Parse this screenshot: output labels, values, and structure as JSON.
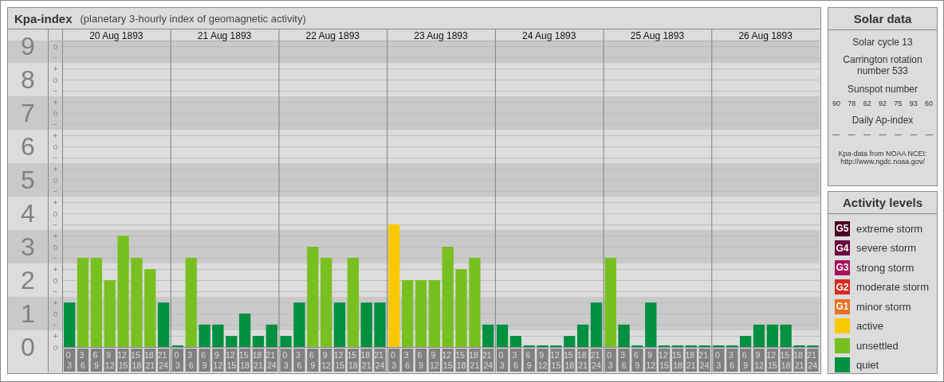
{
  "chart_panel": {
    "title": "Kpa-index",
    "subtitle": "(planetary 3-hourly index of geomagnetic activity)",
    "days": [
      "20 Aug 1893",
      "21 Aug 1893",
      "22 Aug 1893",
      "23 Aug 1893",
      "24 Aug 1893",
      "25 Aug 1893",
      "26 Aug 1893"
    ],
    "kp_steps": [
      "o",
      "−",
      "+",
      "o",
      "−",
      "+",
      "o",
      "−",
      "+",
      "o",
      "−",
      "+",
      "o",
      "−",
      "+",
      "o",
      "−",
      "+",
      "o",
      "−",
      "+",
      "o",
      "−",
      "+",
      "o",
      "−",
      "+",
      "o"
    ],
    "chart_data": {
      "type": "bar",
      "grid": true,
      "ylim": [
        0,
        9.17
      ],
      "categories": [
        "0 3",
        "3 6",
        "6 9",
        "9 12",
        "12 15",
        "15 18",
        "18 21",
        "21 24",
        "0 3",
        "3 6",
        "6 9",
        "9 12",
        "12 15",
        "15 18",
        "18 21",
        "21 24",
        "0 3",
        "3 6",
        "6 9",
        "9 12",
        "12 15",
        "15 18",
        "18 21",
        "21 24",
        "0 3",
        "3 6",
        "6 9",
        "9 12",
        "12 15",
        "15 18",
        "18 21",
        "21 24",
        "0 3",
        "3 6",
        "6 9",
        "9 12",
        "12 15",
        "15 18",
        "18 21",
        "21 24",
        "0 3",
        "3 6",
        "6 9",
        "9 12",
        "12 15",
        "15 18",
        "18 21",
        "21 24",
        "0 3",
        "3 6",
        "6 9",
        "9 12",
        "12 15",
        "15 18",
        "18 21",
        "21 24"
      ],
      "yticks": [
        {
          "value": 0,
          "label": "0"
        },
        {
          "value": 1,
          "label": "1"
        },
        {
          "value": 2,
          "label": "2"
        },
        {
          "value": 3,
          "label": "3"
        },
        {
          "value": 4,
          "label": "4"
        },
        {
          "value": 5,
          "label": "5"
        },
        {
          "value": 6,
          "label": "6"
        },
        {
          "value": 7,
          "label": "7"
        },
        {
          "value": 8,
          "label": "8"
        },
        {
          "value": 9,
          "label": "9"
        }
      ],
      "series": [
        {
          "color": "#009040",
          "values": [
            1.33,
            null,
            null,
            null,
            null,
            null,
            null,
            1.33,
            0,
            null,
            0.67,
            0.67,
            0.33,
            1,
            0.33,
            0.67,
            0.33,
            1.33,
            null,
            null,
            1.33,
            null,
            1.33,
            1.33,
            null,
            null,
            null,
            null,
            null,
            null,
            null,
            0.67,
            0.67,
            0.33,
            0,
            0,
            0,
            0.33,
            0.67,
            1.33,
            null,
            0.67,
            0,
            1.33,
            0,
            0,
            0,
            0,
            0,
            0,
            0.33,
            0.67,
            0.67,
            0.67,
            0,
            0
          ]
        },
        {
          "color": "#78c020",
          "values": [
            null,
            2.67,
            2.67,
            2,
            3.33,
            2.67,
            2.33,
            null,
            null,
            2.67,
            null,
            null,
            null,
            null,
            null,
            null,
            null,
            null,
            3,
            2.67,
            null,
            2.67,
            null,
            null,
            null,
            2,
            2,
            2,
            3,
            2.33,
            2.67,
            null,
            null,
            null,
            null,
            null,
            null,
            null,
            null,
            null,
            2.67,
            null,
            null,
            null,
            null,
            null,
            null,
            null,
            null,
            null,
            null,
            null,
            null,
            null,
            null,
            null
          ]
        },
        {
          "color": "#f8c800",
          "values": [
            null,
            null,
            null,
            null,
            null,
            null,
            null,
            null,
            null,
            null,
            null,
            null,
            null,
            null,
            null,
            null,
            null,
            null,
            null,
            null,
            null,
            null,
            null,
            null,
            3.67,
            null,
            null,
            null,
            null,
            null,
            null,
            null,
            null,
            null,
            null,
            null,
            null,
            null,
            null,
            null,
            null,
            null,
            null,
            null,
            null,
            null,
            null,
            null,
            null,
            null,
            null,
            null,
            null,
            null,
            null,
            null
          ]
        }
      ]
    }
  },
  "solar_data": {
    "title": "Solar data",
    "solar_cycle": "Solar cycle 13",
    "carrington_rotation": "Carrington rotation number 533",
    "sunspot_label": "Sunspot number",
    "sunspot_numbers": [
      "90",
      "78",
      "62",
      "92",
      "75",
      "93",
      "60"
    ],
    "ap_label": "Daily Ap-index",
    "ap_values": [
      "—",
      "—",
      "—",
      "—",
      "—",
      "—",
      "—"
    ],
    "source": "Kpa-data from NOAA NCEI:",
    "source_url": "http://www.ngdc.noaa.gov/"
  },
  "activity_levels": {
    "title": "Activity levels",
    "items": [
      {
        "badge": "G5",
        "label": "extreme storm",
        "color": "#4a0022"
      },
      {
        "badge": "G4",
        "label": "severe storm",
        "color": "#6a0040"
      },
      {
        "badge": "G3",
        "label": "strong storm",
        "color": "#a8105c"
      },
      {
        "badge": "G2",
        "label": "moderate storm",
        "color": "#d82a20"
      },
      {
        "badge": "G1",
        "label": "minor storm",
        "color": "#e87020"
      },
      {
        "label": "active",
        "color": "#f8c800"
      },
      {
        "label": "unsettled",
        "color": "#78c020"
      },
      {
        "label": "quiet",
        "color": "#009040"
      }
    ]
  }
}
